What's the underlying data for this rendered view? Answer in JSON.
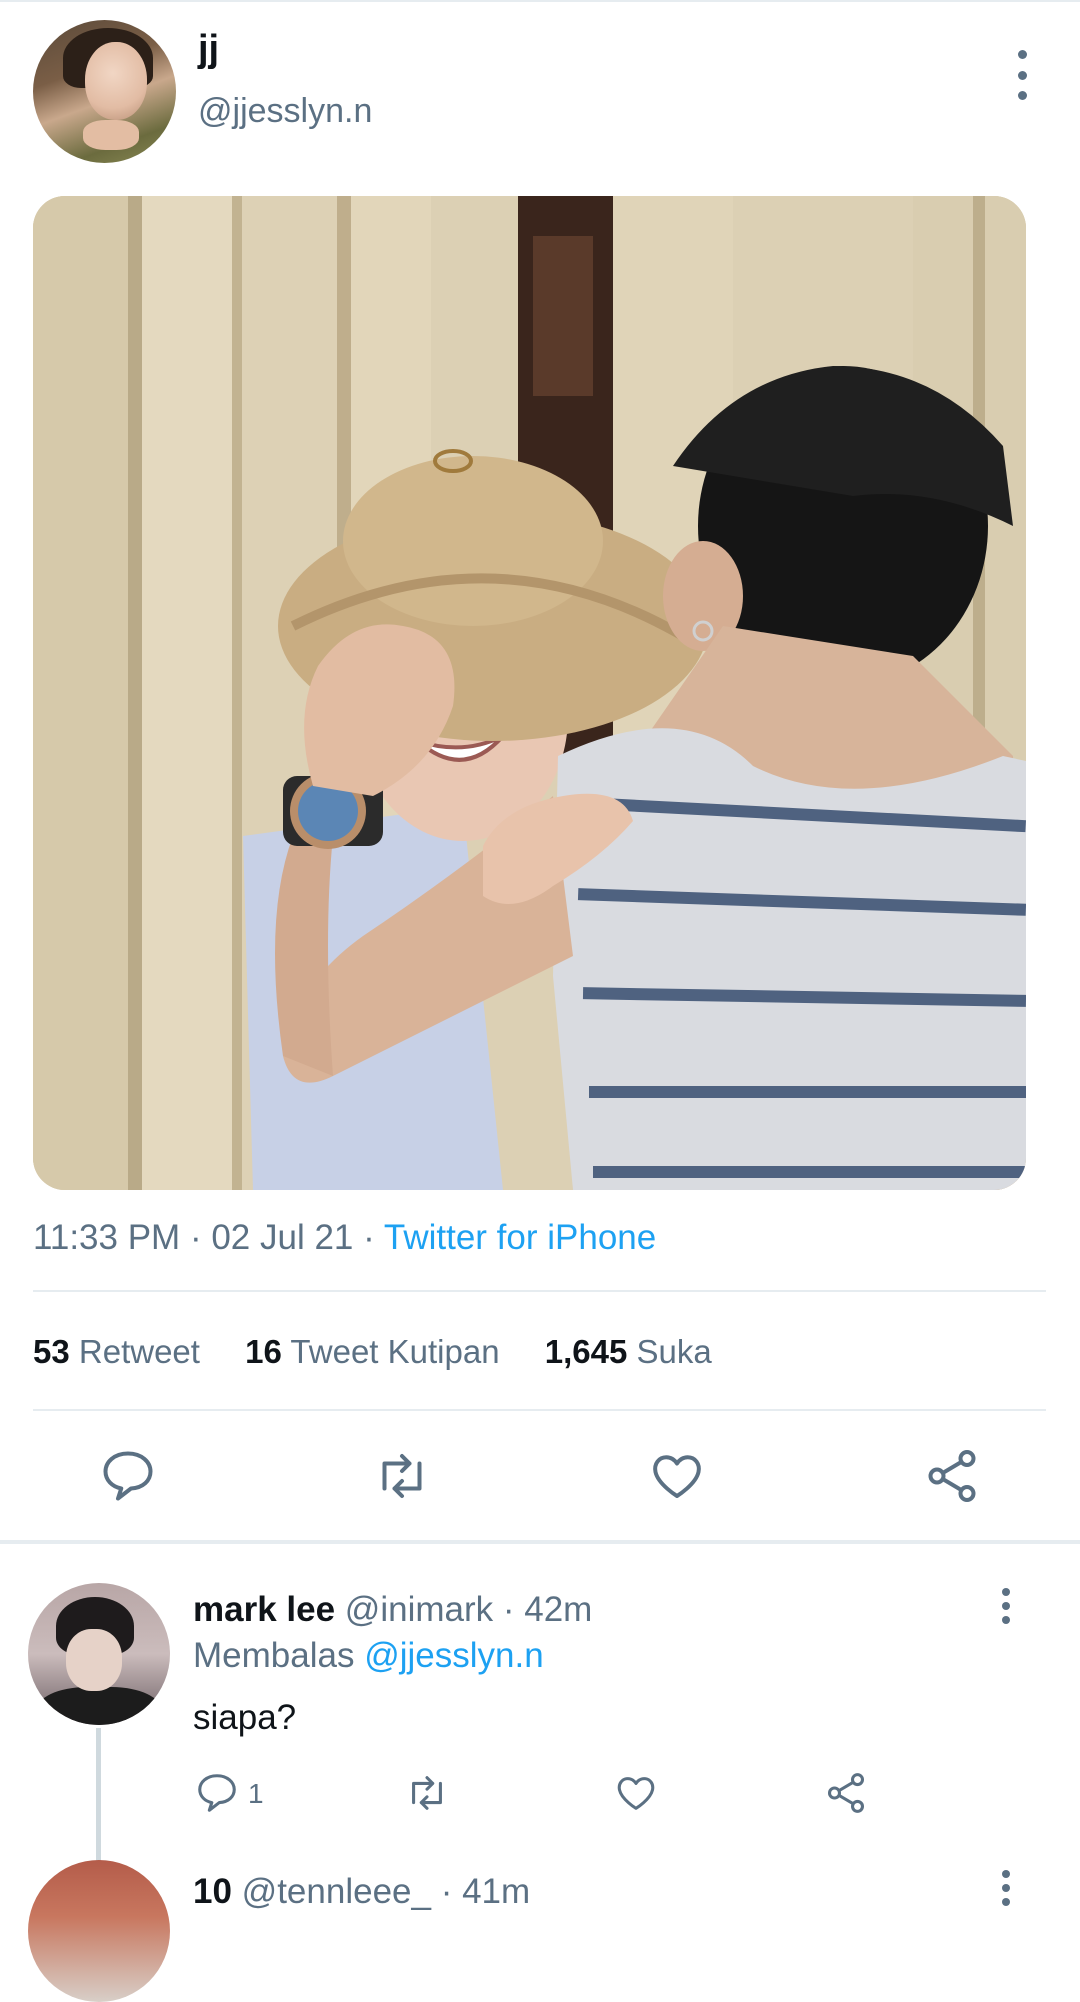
{
  "tweet": {
    "display_name": "jj",
    "handle": "@jjesslyn.n",
    "time": "11:33 PM",
    "date": "02 Jul 21",
    "source": "Twitter for iPhone",
    "stats": {
      "retweets": "53",
      "retweets_label": "Retweet",
      "quotes": "16",
      "quotes_label": "Tweet Kutipan",
      "likes": "1,645",
      "likes_label": "Suka"
    },
    "actions": [
      "reply-icon",
      "retweet-icon",
      "like-icon",
      "share-icon"
    ]
  },
  "replies": [
    {
      "display_name": "mark lee",
      "handle": "@inimark",
      "age": "42m",
      "replying_prefix": "Membalas",
      "replying_to": "@jjesslyn.n",
      "text": "siapa?",
      "reply_count": "1"
    },
    {
      "display_name": "10",
      "handle": "@tennleee_",
      "age": "41m"
    }
  ],
  "colors": {
    "accent": "#1da1f2",
    "secondary_text": "#5b7083",
    "icon": "#5b7083"
  }
}
